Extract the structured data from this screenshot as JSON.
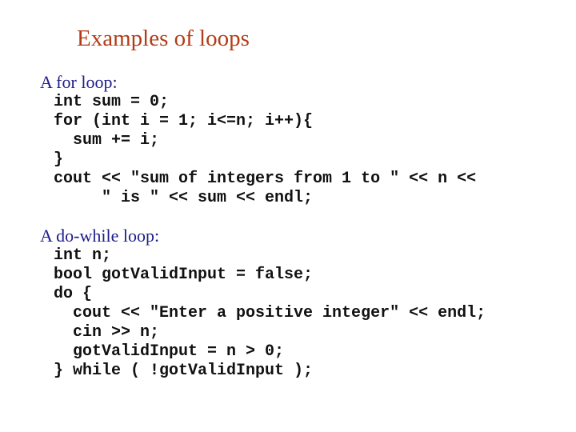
{
  "slide": {
    "title": "Examples of loops",
    "colors": {
      "title": "#b23c17",
      "heading": "#1c1c8a",
      "code": "#111111",
      "background": "#ffffff"
    },
    "sections": [
      {
        "heading": "A for loop:",
        "code_lines": [
          "int sum = 0;",
          "for (int i = 1; i<=n; i++){",
          "  sum += i;",
          "}",
          "cout << \"sum of integers from 1 to \" << n <<",
          "     \" is \" << sum << endl;"
        ]
      },
      {
        "heading": "A do-while loop:",
        "code_lines": [
          "int n;",
          "bool gotValidInput = false;",
          "do {",
          "  cout << \"Enter a positive integer\" << endl;",
          "  cin >> n;",
          "  gotValidInput = n > 0;",
          "} while ( !gotValidInput );"
        ]
      }
    ]
  }
}
